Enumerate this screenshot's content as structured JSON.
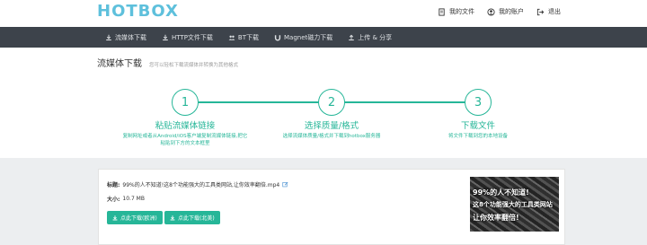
{
  "header": {
    "logo": "HOTBOX",
    "links": [
      {
        "label": "我的文件",
        "icon": "document-icon"
      },
      {
        "label": "我的账户",
        "icon": "user-icon"
      },
      {
        "label": "退出",
        "icon": "logout-icon"
      }
    ]
  },
  "nav": {
    "items": [
      {
        "label": "流媒体下载",
        "icon": "download-icon"
      },
      {
        "label": "HTTP文件下载",
        "icon": "download-icon"
      },
      {
        "label": "BT下载",
        "icon": "users-icon"
      },
      {
        "label": "Magnet磁力下载",
        "icon": "magnet-icon"
      },
      {
        "label": "上传 & 分享",
        "icon": "upload-icon"
      }
    ]
  },
  "page": {
    "title": "流媒体下载",
    "subtitle": "您可以轻松下载流媒体并转换为其他格式"
  },
  "steps": [
    {
      "num": "1",
      "title": "粘贴流媒体链接",
      "desc1": "复制网址或者从Android/iOS客户端复制流媒体链接,把它",
      "desc2": "粘贴到下方的文本框里"
    },
    {
      "num": "2",
      "title": "选择质量/格式",
      "desc1": "选择流媒体质量/格式并下载到hotbox服务器",
      "desc2": ""
    },
    {
      "num": "3",
      "title": "下载文件",
      "desc1": "将文件下载到您的本地设备",
      "desc2": ""
    }
  ],
  "file": {
    "title_label": "标题:",
    "title_value": "99%的人不知道!这8个功能强大的工具类网站,让你效率翻倍.mp4",
    "size_label": "大小:",
    "size_value": "10.7 MB",
    "btn_eu": "点此下载(欧洲)",
    "btn_na": "点此下载(北美)",
    "thumb_lines": [
      "99%的人不知道!",
      "这8个功能强大的工具类网站",
      "让你效率翻倍!"
    ]
  },
  "colors": {
    "accent": "#26b698",
    "navbar": "#3d434b",
    "logo": "#5ec0dc"
  }
}
